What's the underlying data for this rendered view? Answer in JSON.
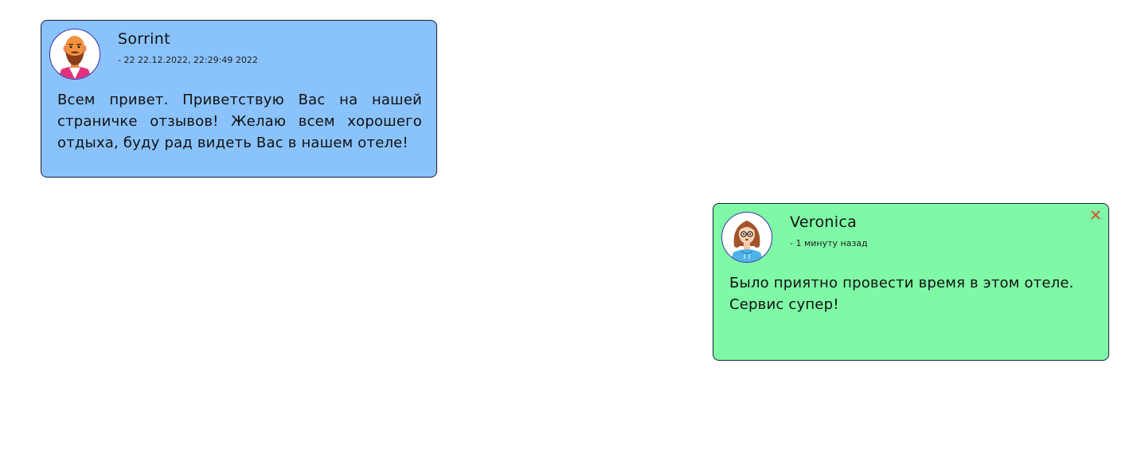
{
  "comments": [
    {
      "author": "Sorrint",
      "meta": "- 22 22.12.2022, 22:29:49 2022",
      "text": "Всем привет. Приветствую Вас на нашей страничке отзывов! Желаю всем хорошего отдыха, буду рад видеть Вас в нашем отеле!",
      "background": "#8ac3fb",
      "avatar_icon": "bearded-man-avatar-icon"
    },
    {
      "author": "Veronica",
      "meta": "- 1 минуту назад",
      "text": "Было приятно провести время в этом отеле. Сервис супер!",
      "background": "#7ff9a6",
      "avatar_icon": "woman-glasses-avatar-icon",
      "close_icon": "close-icon",
      "close_color": "#d9472b"
    }
  ]
}
